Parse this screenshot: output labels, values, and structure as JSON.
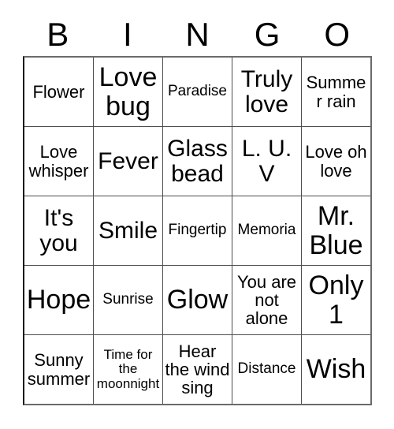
{
  "card": {
    "title_letters": [
      "B",
      "I",
      "N",
      "G",
      "O"
    ],
    "columns": 5,
    "rows": 5,
    "background_color": "#ffffff",
    "text_color": "#000000",
    "border_color": "#4d4d4d",
    "cells": [
      [
        {
          "text": "Flower",
          "size": "lg"
        },
        {
          "text": "Love bug",
          "size": "3xl"
        },
        {
          "text": "Paradise",
          "size": "md"
        },
        {
          "text": "Truly love",
          "size": "2xl"
        },
        {
          "text": "Summer rain",
          "size": "lg"
        }
      ],
      [
        {
          "text": "Love whisper",
          "size": "lg"
        },
        {
          "text": "Fever",
          "size": "2xl"
        },
        {
          "text": "Glass bead",
          "size": "2xl"
        },
        {
          "text": "L. U. V",
          "size": "2xl"
        },
        {
          "text": "Love oh love",
          "size": "lg"
        }
      ],
      [
        {
          "text": "It's you",
          "size": "2xl"
        },
        {
          "text": "Smile",
          "size": "2xl"
        },
        {
          "text": "Fingertip",
          "size": "md"
        },
        {
          "text": "Memoria",
          "size": "md"
        },
        {
          "text": "Mr. Blue",
          "size": "3xl"
        }
      ],
      [
        {
          "text": "Hope",
          "size": "3xl"
        },
        {
          "text": "Sunrise",
          "size": "md"
        },
        {
          "text": "Glow",
          "size": "3xl"
        },
        {
          "text": "You are not alone",
          "size": "lg"
        },
        {
          "text": "Only 1",
          "size": "3xl"
        }
      ],
      [
        {
          "text": "Sunny summer",
          "size": "lg"
        },
        {
          "text": "Time for the moonnight",
          "size": "sm"
        },
        {
          "text": "Hear the wind sing",
          "size": "lg"
        },
        {
          "text": "Distance",
          "size": "md"
        },
        {
          "text": "Wish",
          "size": "3xl"
        }
      ]
    ]
  }
}
